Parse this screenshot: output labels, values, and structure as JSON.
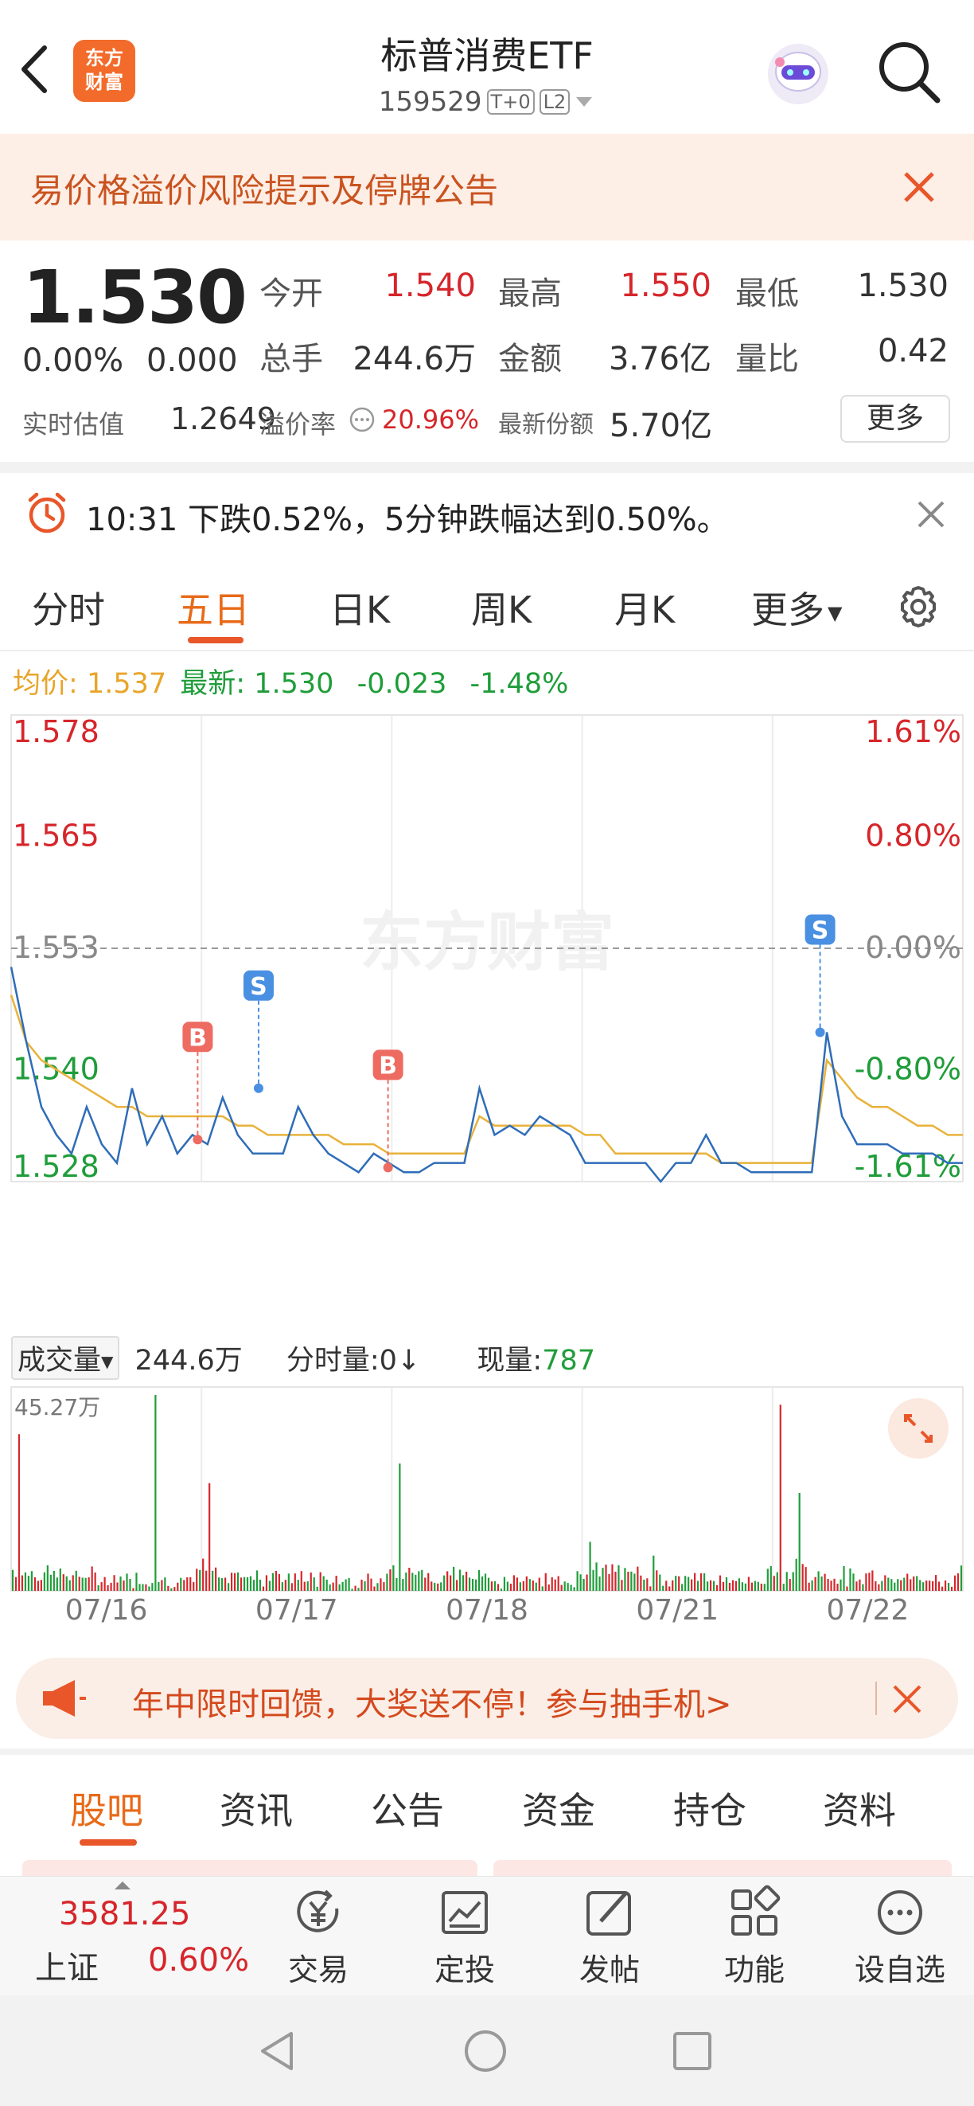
{
  "header": {
    "title": "标普消费ETF",
    "code": "159529",
    "badge_t0": "T+0",
    "badge_l2": "L2",
    "logo_text_1": "东方",
    "logo_text_2": "财富"
  },
  "notice": {
    "text": "易价格溢价风险提示及停牌公告"
  },
  "quote": {
    "price": "1.530",
    "change_pct": "0.00%",
    "change": "0.000",
    "open_label": "今开",
    "open": "1.540",
    "high_label": "最高",
    "high": "1.550",
    "low_label": "最低",
    "low": "1.530",
    "volume_label": "总手",
    "volume": "244.6万",
    "amount_label": "金额",
    "amount": "3.76亿",
    "ratio_label": "量比",
    "ratio": "0.42",
    "iopv_label": "实时估值",
    "iopv": "1.2649",
    "premium_label": "溢价率",
    "premium": "20.96%",
    "shares_label": "最新份额",
    "shares": "5.70亿",
    "more_button": "更多"
  },
  "alert": {
    "text": "10:31 下跌0.52%，5分钟跌幅达到0.50%。"
  },
  "tabs": {
    "items": [
      "分时",
      "五日",
      "日K",
      "周K",
      "月K",
      "更多"
    ],
    "active": "五日"
  },
  "chart_info": {
    "avg_label": "均价:",
    "avg": "1.537",
    "latest_label": "最新:",
    "latest": "1.530",
    "change": "-0.023",
    "change_pct": "-1.48%",
    "watermark": "东方财富"
  },
  "volume_info": {
    "label": "成交量",
    "total": "244.6万",
    "min_vol_label": "分时量:0↓",
    "current_label": "现量:",
    "current": "787",
    "max_label": "45.27万"
  },
  "chart_data": {
    "type": "line",
    "y_left_ticks": [
      "1.578",
      "1.565",
      "1.553",
      "1.540",
      "1.528"
    ],
    "y_right_ticks": [
      "1.61%",
      "0.80%",
      "0.00%",
      "-0.80%",
      "-1.61%"
    ],
    "ylim": [
      1.528,
      1.578
    ],
    "prev_close": 1.553,
    "x_labels": [
      "07/16",
      "07/17",
      "07/18",
      "07/21",
      "07/22"
    ],
    "series": [
      {
        "name": "最新",
        "color": "#2f6db8",
        "values": [
          1.551,
          1.543,
          1.536,
          1.533,
          1.531,
          1.536,
          1.532,
          1.53,
          1.538,
          1.532,
          1.535,
          1.531,
          1.533,
          1.532,
          1.537,
          1.533,
          1.531,
          1.531,
          1.531,
          1.536,
          1.533,
          1.531,
          1.53,
          1.529,
          1.531,
          1.53,
          1.529,
          1.529,
          1.53,
          1.53,
          1.53,
          1.538,
          1.533,
          1.534,
          1.533,
          1.535,
          1.534,
          1.533,
          1.53,
          1.53,
          1.53,
          1.53,
          1.53,
          1.528,
          1.53,
          1.53,
          1.533,
          1.53,
          1.53,
          1.529,
          1.529,
          1.529,
          1.529,
          1.529,
          1.544,
          1.535,
          1.532,
          1.532,
          1.532,
          1.531,
          1.531,
          1.531,
          1.53,
          1.53
        ]
      },
      {
        "name": "均价",
        "color": "#e8b23a",
        "values": [
          1.548,
          1.543,
          1.541,
          1.54,
          1.539,
          1.538,
          1.537,
          1.536,
          1.536,
          1.535,
          1.535,
          1.535,
          1.535,
          1.535,
          1.535,
          1.534,
          1.534,
          1.533,
          1.533,
          1.533,
          1.533,
          1.533,
          1.532,
          1.532,
          1.532,
          1.531,
          1.531,
          1.531,
          1.531,
          1.531,
          1.531,
          1.535,
          1.534,
          1.534,
          1.534,
          1.534,
          1.534,
          1.534,
          1.533,
          1.533,
          1.531,
          1.531,
          1.531,
          1.531,
          1.531,
          1.531,
          1.531,
          1.53,
          1.53,
          1.53,
          1.53,
          1.53,
          1.53,
          1.53,
          1.541,
          1.539,
          1.537,
          1.536,
          1.536,
          1.535,
          1.534,
          1.534,
          1.533,
          1.533
        ]
      }
    ],
    "markers": [
      {
        "label": "B",
        "day": 0,
        "pos": 0.98,
        "value": 1.5325,
        "color": "#ee6b61"
      },
      {
        "label": "S",
        "day": 1,
        "pos": 0.3,
        "value": 1.538,
        "color": "#4a90e2"
      },
      {
        "label": "B",
        "day": 1,
        "pos": 0.98,
        "value": 1.5295,
        "color": "#ee6b61"
      },
      {
        "label": "S",
        "day": 4,
        "pos": 0.25,
        "value": 1.544,
        "color": "#4a90e2"
      }
    ],
    "grid": true
  },
  "banner": {
    "text": "年中限时回馈，大奖送不停！参与抽手机>"
  },
  "bottom_tabs": {
    "items": [
      "股吧",
      "资讯",
      "公告",
      "资金",
      "持仓",
      "资料"
    ],
    "active": "股吧"
  },
  "tabbar": {
    "index_value": "3581.25",
    "index_name": "上证",
    "index_change": "0.60%",
    "items": [
      "交易",
      "定投",
      "发帖",
      "功能",
      "设自选"
    ]
  }
}
